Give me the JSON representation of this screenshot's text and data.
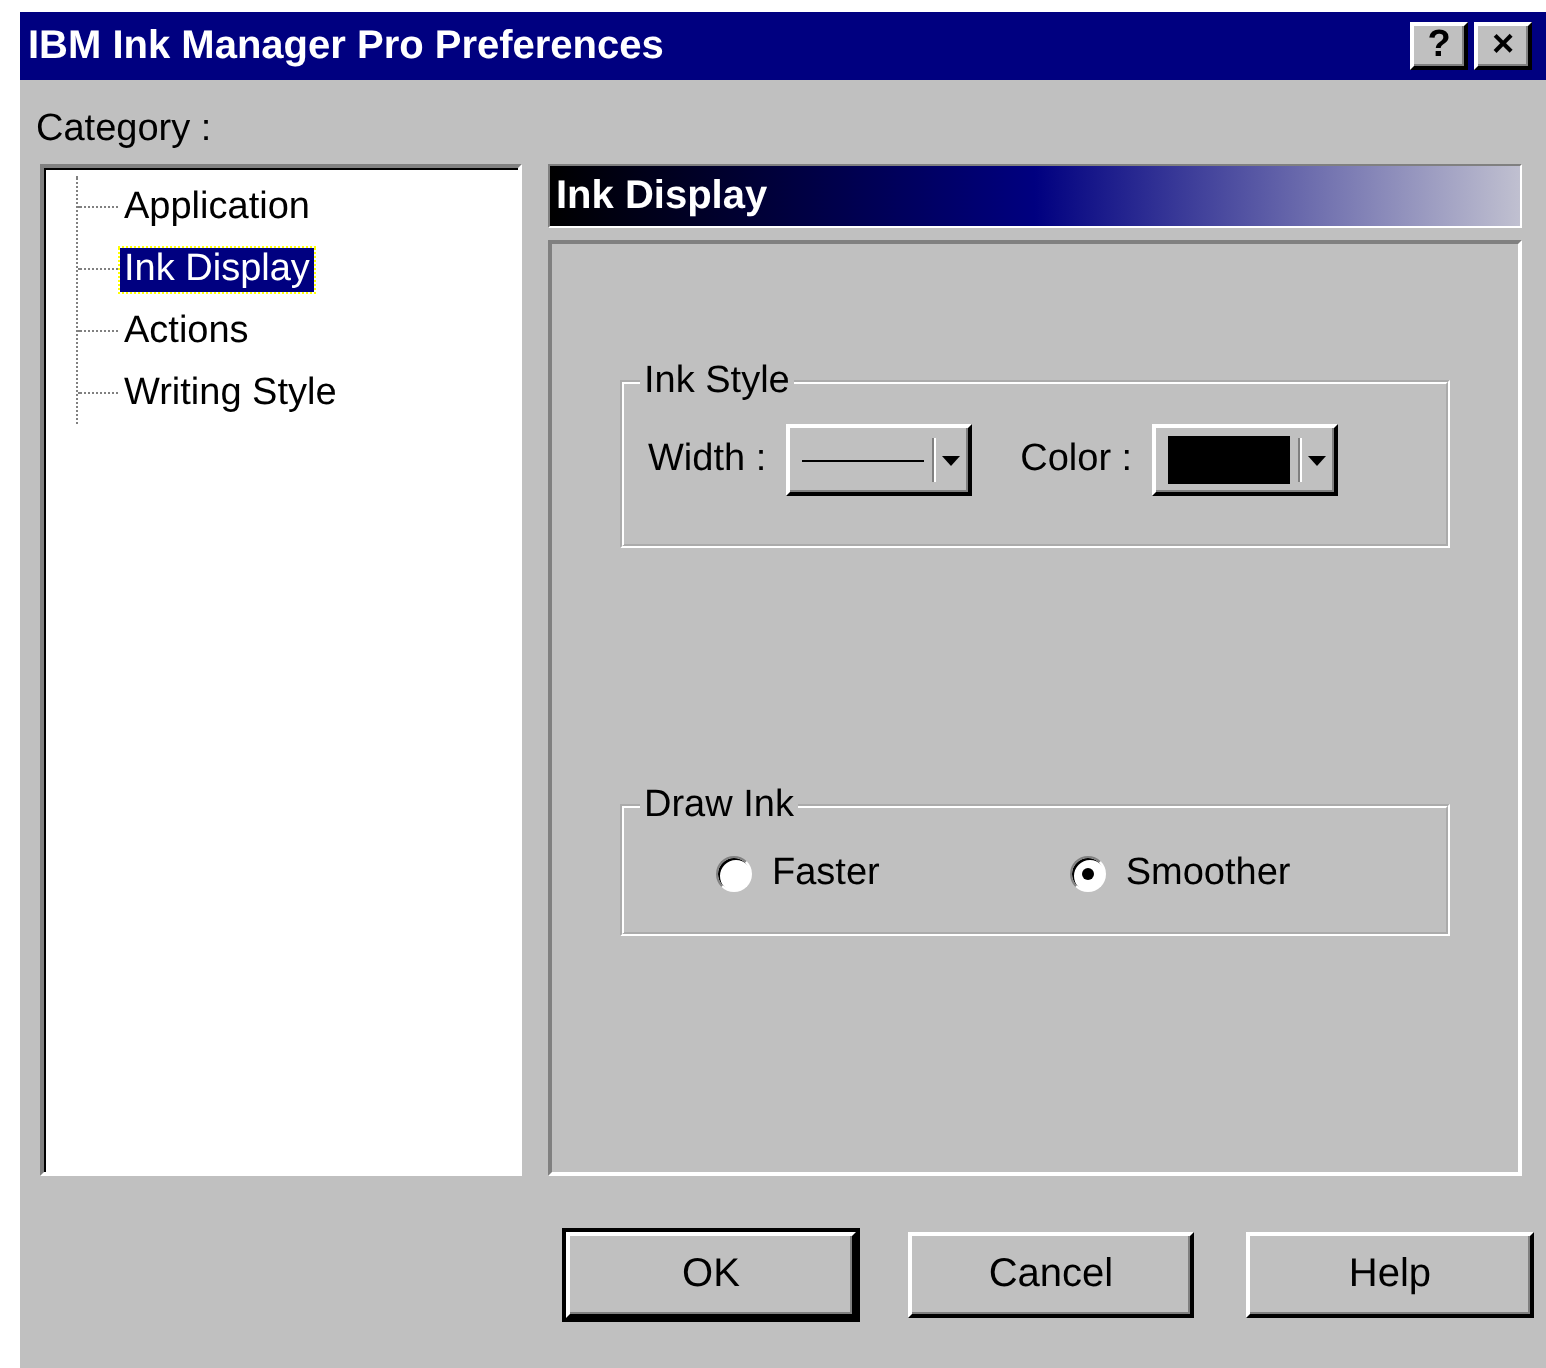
{
  "window": {
    "title": "IBM Ink Manager Pro Preferences",
    "title_buttons": [
      "?",
      "×"
    ]
  },
  "category_label": "Category :",
  "categories": [
    {
      "label": "Application",
      "selected": false
    },
    {
      "label": "Ink Display",
      "selected": true
    },
    {
      "label": "Actions",
      "selected": false
    },
    {
      "label": "Writing Style",
      "selected": false
    }
  ],
  "panel": {
    "title": "Ink Display",
    "ink_style": {
      "label": "Ink Style",
      "width_label": "Width :",
      "color_label": "Color :"
    },
    "draw_ink": {
      "label": "Draw Ink",
      "options": [
        {
          "label": "Faster",
          "selected": false
        },
        {
          "label": "Smoother",
          "selected": true
        }
      ]
    }
  },
  "buttons": [
    {
      "label": "OK",
      "default": true
    },
    {
      "label": "Cancel",
      "default": false
    },
    {
      "label": "Help",
      "default": false
    }
  ]
}
